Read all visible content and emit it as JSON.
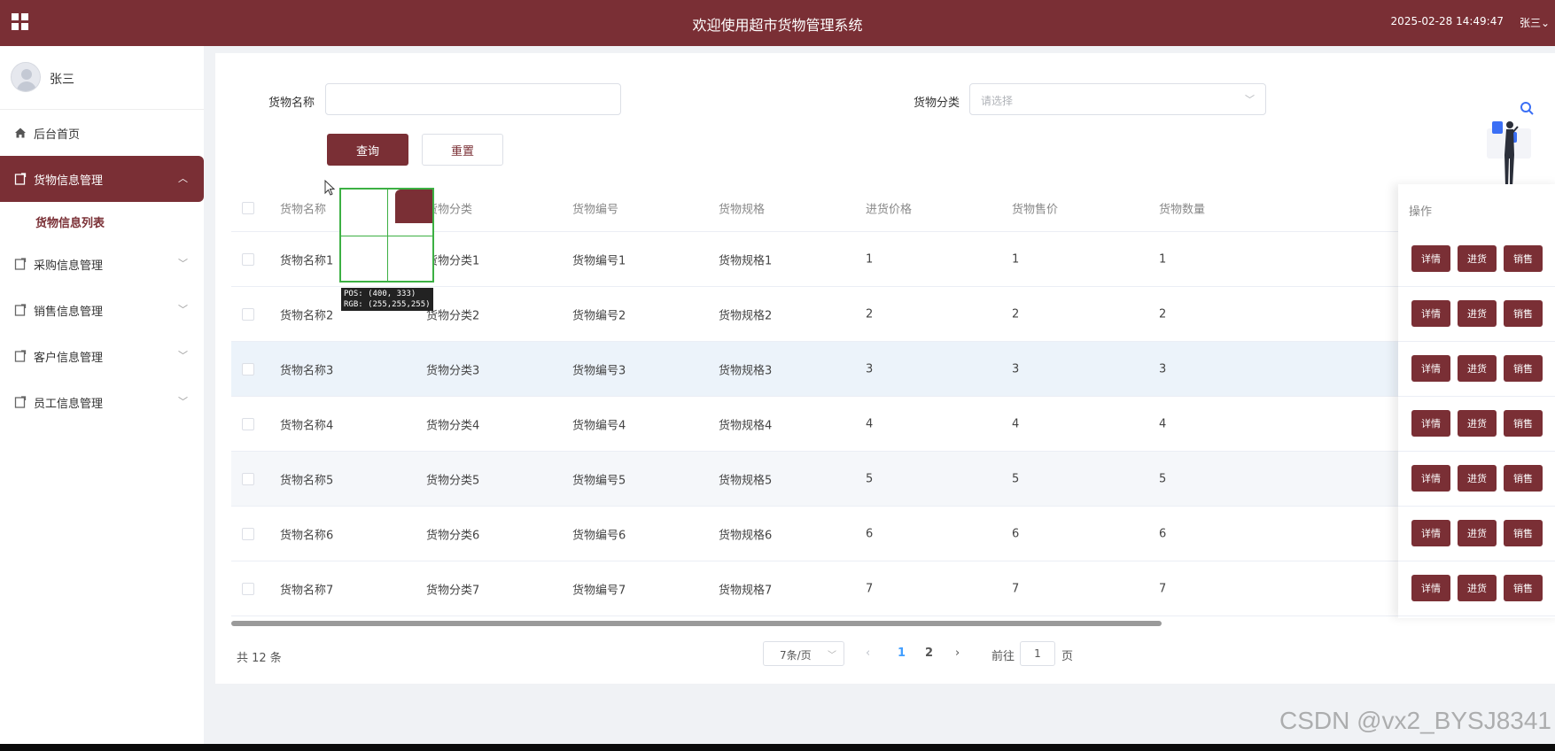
{
  "header": {
    "title": "欢迎使用超市货物管理系统",
    "datetime": "2025-02-28 14:49:47",
    "user": "张三⌄"
  },
  "sidebar": {
    "profile_name": "张三",
    "items": [
      {
        "label": "后台首页"
      },
      {
        "label": "货物信息管理",
        "active": true
      },
      {
        "label": "采购信息管理"
      },
      {
        "label": "销售信息管理"
      },
      {
        "label": "客户信息管理"
      },
      {
        "label": "员工信息管理"
      }
    ],
    "submenu": {
      "label": "货物信息列表"
    }
  },
  "search": {
    "name_label": "货物名称",
    "name_value": "",
    "category_label": "货物分类",
    "category_placeholder": "请选择",
    "query_button": "查询",
    "reset_button": "重置"
  },
  "table": {
    "columns": [
      "货物名称",
      "货物分类",
      "货物编号",
      "货物规格",
      "进货价格",
      "货物售价",
      "货物数量",
      "操作"
    ],
    "rows": [
      [
        "货物名称1",
        "货物分类1",
        "货物编号1",
        "货物规格1",
        "1",
        "1",
        "1"
      ],
      [
        "货物名称2",
        "货物分类2",
        "货物编号2",
        "货物规格2",
        "2",
        "2",
        "2"
      ],
      [
        "货物名称3",
        "货物分类3",
        "货物编号3",
        "货物规格3",
        "3",
        "3",
        "3"
      ],
      [
        "货物名称4",
        "货物分类4",
        "货物编号4",
        "货物规格4",
        "4",
        "4",
        "4"
      ],
      [
        "货物名称5",
        "货物分类5",
        "货物编号5",
        "货物规格5",
        "5",
        "5",
        "5"
      ],
      [
        "货物名称6",
        "货物分类6",
        "货物编号6",
        "货物规格6",
        "6",
        "6",
        "6"
      ],
      [
        "货物名称7",
        "货物分类7",
        "货物编号7",
        "货物规格7",
        "7",
        "7",
        "7"
      ]
    ],
    "actions": [
      "详情",
      "进货",
      "销售"
    ]
  },
  "pagination": {
    "total": "共 12 条",
    "page_size": "7条/页",
    "prev": "‹",
    "pages": [
      "1",
      "2"
    ],
    "current": "1",
    "next": "›",
    "goto_label": "前往",
    "goto_value": "1",
    "page_suffix": "页"
  },
  "overlay": {
    "pos": "POS: (400, 333)",
    "rgb": "RGB: (255,255,255)"
  },
  "watermark": "CSDN @vx2_BYSJ8341",
  "colors": {
    "primary": "#7a2f35",
    "link": "#409eff"
  }
}
